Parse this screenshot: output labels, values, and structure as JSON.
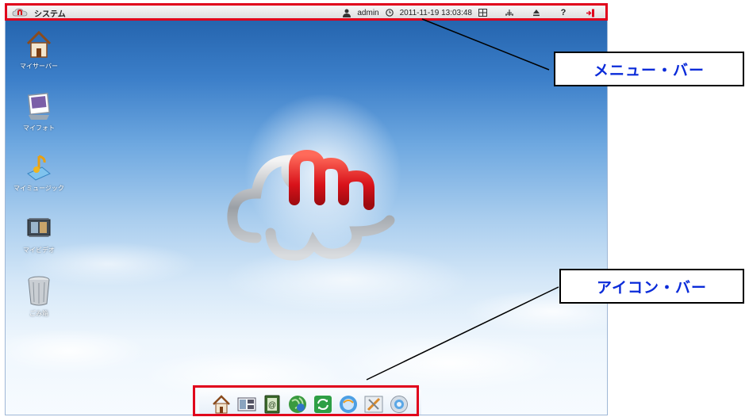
{
  "menu_bar": {
    "system_label": "システム",
    "user": "admin",
    "datetime": "2011-11-19 13:03:48",
    "icons": [
      "user-icon",
      "clock-icon",
      "grid-icon",
      "network-icon",
      "eject-icon",
      "help-icon",
      "logout-icon"
    ]
  },
  "desktop_icons": [
    {
      "name": "my-server",
      "label": "マイサーバー",
      "icon": "house-icon"
    },
    {
      "name": "my-photo",
      "label": "マイフォト",
      "icon": "photo-icon"
    },
    {
      "name": "my-music",
      "label": "マイミュージック",
      "icon": "music-note-icon"
    },
    {
      "name": "my-video",
      "label": "マイビデオ",
      "icon": "film-icon"
    },
    {
      "name": "trash",
      "label": "ごみ箱",
      "icon": "trash-can-icon"
    }
  ],
  "dock_icons": [
    "house-icon",
    "layout-icon",
    "address-book-icon",
    "globe-icon",
    "sync-icon",
    "browser-icon",
    "tools-icon",
    "settings-icon"
  ],
  "callouts": {
    "menu_bar": "メニュー・バー",
    "icon_bar": "アイコン・バー"
  },
  "colors": {
    "highlight_red": "#e0001b",
    "callout_text_blue": "#0a2bd9"
  }
}
